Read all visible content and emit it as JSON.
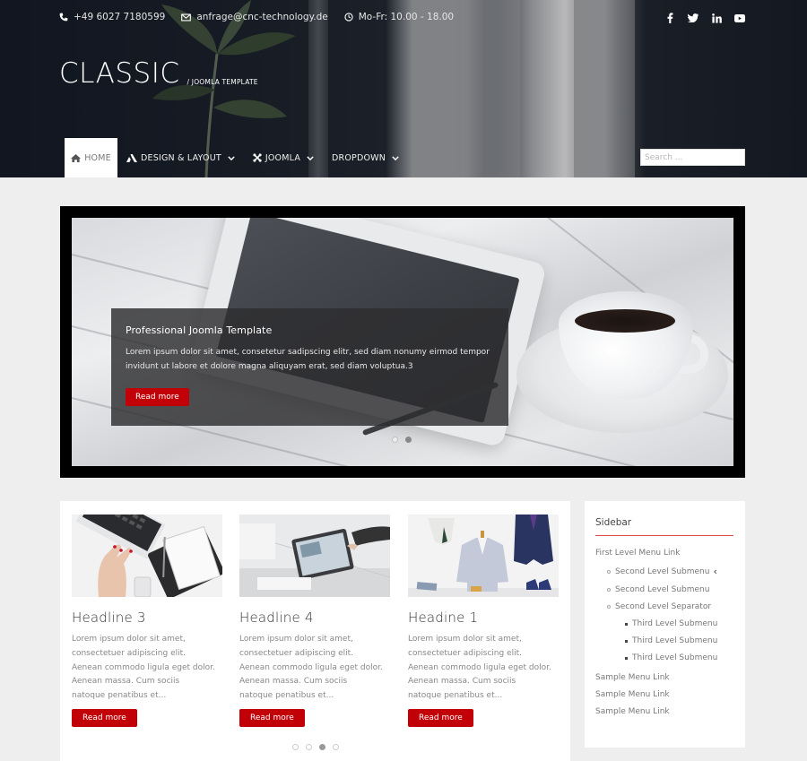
{
  "header": {
    "contact": {
      "phone": "+49 6027 7180599",
      "email": "anfrage@cnc-technology.de",
      "hours": "Mo-Fr: 10.00 - 18.00"
    },
    "social": [
      "facebook",
      "twitter",
      "linkedin",
      "youtube"
    ],
    "brand": {
      "title": "CLASSIC",
      "subtitle": "/ JOOMLA TEMPLATE"
    },
    "nav": [
      {
        "label": "HOME",
        "icon": "home-icon",
        "active": true
      },
      {
        "label": "DESIGN & LAYOUT",
        "icon": "design-icon",
        "dropdown": true
      },
      {
        "label": "JOOMLA",
        "icon": "joomla-icon",
        "dropdown": true
      },
      {
        "label": "DROPDOWN",
        "dropdown": true
      }
    ],
    "search": {
      "placeholder": "Search ...",
      "value": ""
    }
  },
  "slider": {
    "title": "Professional Joomla Template",
    "text": "Lorem ipsum dolor sit amet, consetetur sadipscing elitr, sed diam nonumy eirmod tempor invidunt ut labore et dolore magna aliquyam erat, sed diam voluptua.3",
    "button": "Read more",
    "slides_total": 2,
    "active_slide": 2
  },
  "articles": [
    {
      "headline": "Headline 3",
      "image": "laptop-notebook-photo",
      "text": "Lorem ipsum dolor sit amet, consectetuer adipiscing elit. Aenean commodo ligula eget dolor. Aenean massa. Cum sociis natoque penatibus et...",
      "button": "Read more"
    },
    {
      "headline": "Headline 4",
      "image": "tablet-desk-photo",
      "text": "Lorem ipsum dolor sit amet, consectetuer adipiscing elit. Aenean commodo ligula eget dolor. Aenean massa. Cum sociis natoque penatibus et...",
      "button": "Read more"
    },
    {
      "headline": "Headine 1",
      "image": "suit-mannequin-photo",
      "text": "Lorem ipsum dolor sit amet, consectetuer adipiscing elit. Aenean commodo ligula eget dolor. Aenean massa. Cum sociis natoque penatibus et...",
      "button": "Read more"
    }
  ],
  "articles_pager": {
    "pages_total": 4,
    "active_page": 3
  },
  "sidebar": {
    "title": "Sidebar",
    "first_level": "First Level Menu Link",
    "second_level": [
      "Second Level Submenu",
      "Second Level Submenu",
      "Second Level Separator"
    ],
    "third_level": [
      "Third Level Submenu",
      "Third Level Submenu",
      "Third Level Submenu"
    ],
    "sample_links": [
      "Sample Menu Link",
      "Sample Menu Link",
      "Sample Menu Link"
    ]
  },
  "colors": {
    "accent_red": "#c10007",
    "sidebar_rule": "#d84a4a",
    "page_bg": "#eeeeee",
    "header_dark": "#141821"
  }
}
